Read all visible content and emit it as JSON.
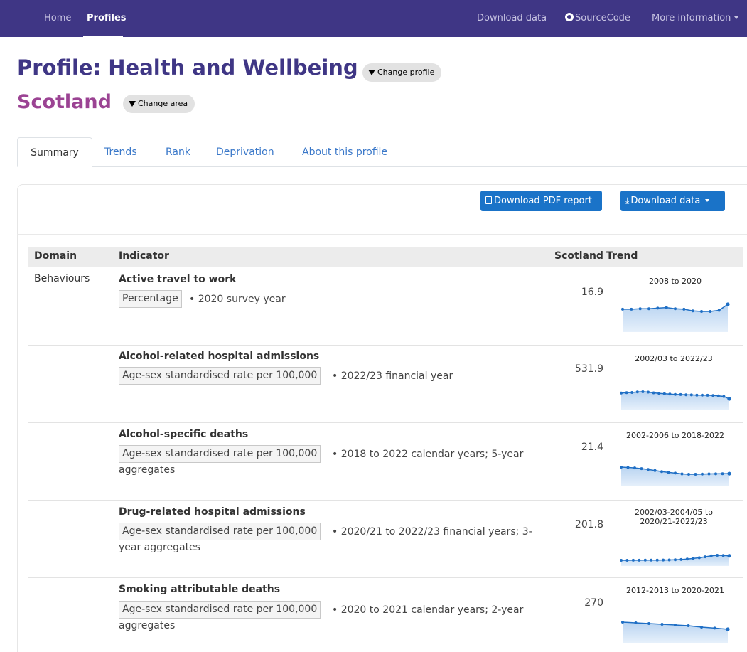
{
  "nav": {
    "home": "Home",
    "profiles": "Profiles",
    "download_data": "Download data",
    "source_code": "SourceCode",
    "more_information": "More information"
  },
  "header": {
    "profile_title": "Profile: Health and Wellbeing",
    "change_profile": "Change profile",
    "area_title": "Scotland",
    "change_area": "Change area"
  },
  "tabs": [
    "Summary",
    "Trends",
    "Rank",
    "Deprivation",
    "About this profile"
  ],
  "toolbar": {
    "download_pdf": "Download PDF report",
    "download_data": "Download data"
  },
  "table": {
    "headers": {
      "domain": "Domain",
      "indicator": "Indicator",
      "scotland": "Scotland",
      "trend": "Trend"
    },
    "domain": "Behaviours",
    "rows": [
      {
        "title": "Active travel to work",
        "measure": "Percentage",
        "period": "• 2020 survey year",
        "period_cont": "",
        "value": "16.9",
        "trend_label": "2008 to 2020",
        "trend": [
          16.0,
          16.0,
          16.1,
          16.1,
          16.2,
          16.3,
          16.1,
          16.0,
          15.7,
          15.6,
          15.6,
          15.8,
          16.9
        ]
      },
      {
        "title": "Alcohol-related hospital admissions",
        "measure": "Age-sex standardised rate per 100,000",
        "period": "• 2022/23 financial year",
        "period_cont": "",
        "value": "531.9",
        "trend_label": "2002/03 to 2022/23",
        "trend": [
          700,
          710,
          715,
          730,
          735,
          725,
          705,
          690,
          680,
          670,
          660,
          655,
          650,
          645,
          640,
          638,
          635,
          630,
          620,
          600,
          531.9
        ]
      },
      {
        "title": "Alcohol-specific deaths",
        "measure": "Age-sex standardised rate per 100,000",
        "period": "• 2018 to 2022 calendar years; 5-year",
        "period_cont": "aggregates",
        "value": "21.4",
        "trend_label": "2002-2006 to 2018-2022",
        "trend": [
          30.0,
          29.5,
          29.0,
          28.0,
          27.0,
          25.5,
          24.0,
          23.0,
          22.0,
          21.0,
          20.5,
          20.5,
          20.8,
          21.0,
          21.1,
          21.2,
          21.4
        ]
      },
      {
        "title": "Drug-related hospital admissions",
        "measure": "Age-sex standardised rate per 100,000",
        "period": "• 2020/21 to 2022/23 financial years; 3-",
        "period_cont": "year aggregates",
        "value": "201.8",
        "trend_label": "2002/03-2004/05 to 2020/21-2022/23",
        "trend": [
          80,
          80,
          81,
          82,
          83,
          84,
          85,
          87,
          90,
          95,
          102,
          115,
          130,
          150,
          175,
          200,
          215,
          210,
          201.8
        ]
      },
      {
        "title": "Smoking attributable deaths",
        "measure": "Age-sex standardised rate per 100,000",
        "period": "• 2020 to 2021 calendar years; 2-year",
        "period_cont": "aggregates",
        "value": "270",
        "trend_label": "2012-2013 to 2020-2021",
        "trend": [
          320,
          315,
          310,
          305,
          300,
          295,
          285,
          278,
          270
        ]
      }
    ]
  }
}
